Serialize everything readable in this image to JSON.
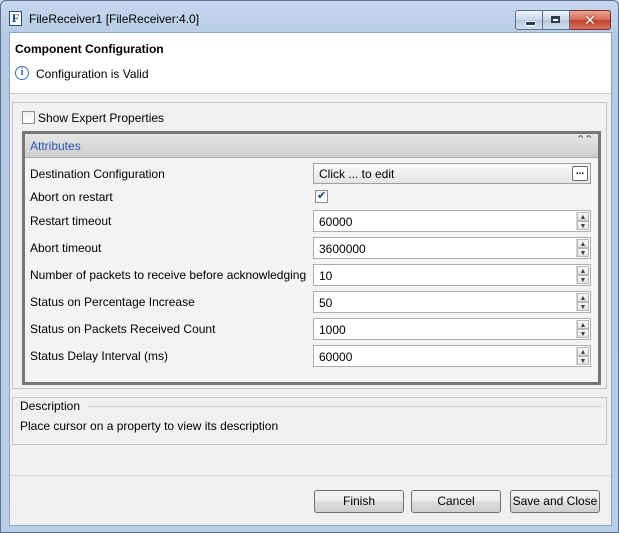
{
  "window": {
    "title": "FileReceiver1 [FileReceiver:4.0]",
    "app_icon_letter": "F",
    "minimize_icon": "minimize-icon",
    "maximize_icon": "maximize-icon",
    "close_icon": "close-icon",
    "close_glyph": "✕"
  },
  "header": {
    "title": "Component Configuration",
    "status": "Configuration is Valid",
    "status_icon": "info-icon",
    "status_glyph": "i"
  },
  "options": {
    "show_expert_label": "Show Expert Properties",
    "show_expert_checked": false
  },
  "attributes": {
    "title": "Attributes",
    "collapse_glyph": "⌃⌃",
    "properties": [
      {
        "label": "Destination Configuration",
        "kind": "edit",
        "value": "Click ... to edit",
        "button_label": "..."
      },
      {
        "label": "Abort on restart",
        "kind": "checkbox",
        "checked": true,
        "check_glyph": "✔"
      },
      {
        "label": "Restart timeout",
        "kind": "spinner",
        "value": "60000"
      },
      {
        "label": "Abort timeout",
        "kind": "spinner",
        "value": "3600000"
      },
      {
        "label": "Number of packets to receive before acknowledging",
        "kind": "spinner",
        "value": "10"
      },
      {
        "label": "Status on Percentage Increase",
        "kind": "spinner",
        "value": "50"
      },
      {
        "label": "Status on Packets Received Count",
        "kind": "spinner",
        "value": "1000"
      },
      {
        "label": "Status Delay Interval (ms)",
        "kind": "spinner",
        "value": "60000"
      }
    ],
    "spin_up_glyph": "▲",
    "spin_down_glyph": "▼"
  },
  "description": {
    "title": "Description",
    "text": "Place cursor on a property to view its description"
  },
  "buttons": {
    "finish": "Finish",
    "cancel": "Cancel",
    "save_close": "Save and Close"
  }
}
